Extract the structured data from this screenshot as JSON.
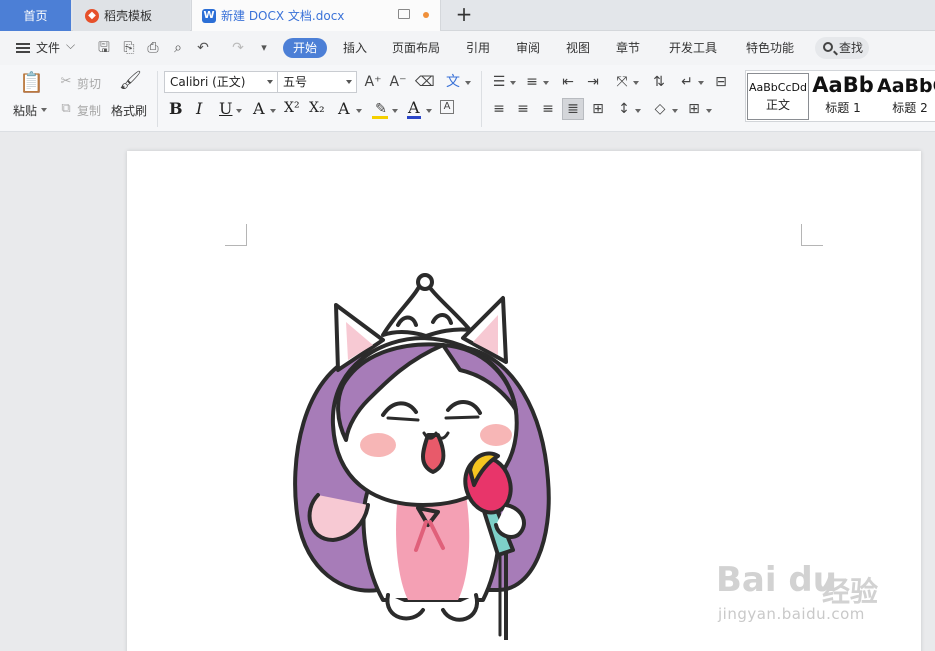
{
  "tabs": {
    "home": "首页",
    "templates": "稻壳模板",
    "document": "新建 DOCX 文档.docx",
    "add": "+"
  },
  "menu": {
    "file": "文件",
    "items": [
      "开始",
      "插入",
      "页面布局",
      "引用",
      "审阅",
      "视图",
      "章节",
      "开发工具",
      "特色功能"
    ],
    "search": "查找"
  },
  "ribbon": {
    "paste": "粘贴",
    "cut": "剪切",
    "copy": "复制",
    "format_painter": "格式刷",
    "font_name": "Calibri (正文)",
    "font_size": "五号",
    "bold": "B",
    "italic": "I",
    "underline": "U",
    "superscript": "X²",
    "subscript": "X₂",
    "styles": [
      {
        "sample": "AaBbCcDd",
        "name": "正文"
      },
      {
        "sample": "AaBb",
        "name": "标题 1"
      },
      {
        "sample": "AaBbC",
        "name": "标题 2"
      }
    ]
  },
  "document": {
    "watermark_brand": "Bai  du",
    "watermark_cn": "经验",
    "watermark_url": "jingyan.baidu.com"
  },
  "colors": {
    "accent": "#4c7fd6",
    "highlight": "#f5d000",
    "font_color": "#2a45c8",
    "cat_purple": "#a77cb8",
    "cat_pink": "#f29cb0",
    "mic_head": "#e8356a",
    "mic_yellow": "#f5c520",
    "mic_neck": "#7ed0c8"
  },
  "icons": [
    "save-icon",
    "undo-icon",
    "redo-icon",
    "print-icon",
    "search-icon",
    "paste-icon",
    "cut-icon",
    "copy-icon",
    "format-painter-icon"
  ]
}
